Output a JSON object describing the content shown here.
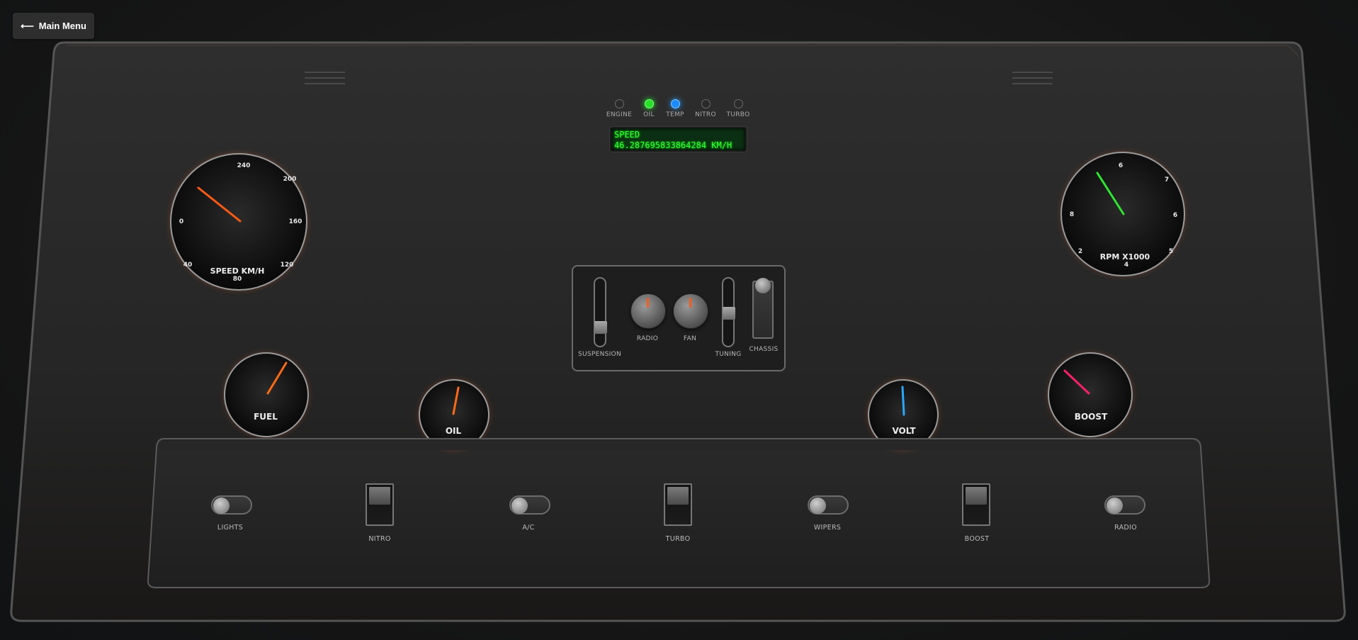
{
  "menu": {
    "arrow": "⟵",
    "label": "Main Menu",
    "icon": "arrow-left-icon"
  },
  "indicators": [
    {
      "label": "ENGINE",
      "state": "off"
    },
    {
      "label": "OIL",
      "state": "green"
    },
    {
      "label": "TEMP",
      "state": "blue"
    },
    {
      "label": "NITRO",
      "state": "off"
    },
    {
      "label": "TURBO",
      "state": "off"
    }
  ],
  "lcd": {
    "line1": "SPEED",
    "line2": "46.287695833864284 KM/H"
  },
  "gauges": {
    "speed": {
      "label": "SPEED KM/H",
      "ticks": [
        "0",
        "40",
        "80",
        "120",
        "160",
        "200",
        "240"
      ],
      "value": 46.287695833864284,
      "min": 0,
      "max": 240,
      "needle_color": "#ff5a14"
    },
    "rpm": {
      "label": "RPM X1000",
      "ticks": [
        "2",
        "4",
        "5",
        "6",
        "7",
        "6",
        "8"
      ],
      "needle_color": "#2ee62e"
    },
    "fuel": {
      "label": "FUEL",
      "needle_color": "#ff6a14"
    },
    "oil": {
      "label": "OIL",
      "needle_color": "#ff6a14"
    },
    "volt": {
      "label": "VOLT",
      "needle_color": "#28a8ff"
    },
    "boost": {
      "label": "BOOST",
      "needle_color": "#ff1f6b"
    }
  },
  "console": {
    "suspension_label": "SUSPENSION",
    "radio_knob_label": "RADIO",
    "fan_knob_label": "FAN",
    "tuning_label": "TUNING",
    "chassis_label": "CHASSIS"
  },
  "switches": [
    {
      "label": "LIGHTS",
      "kind": "toggle",
      "on": false
    },
    {
      "label": "NITRO",
      "kind": "rocker",
      "on": false
    },
    {
      "label": "A/C",
      "kind": "toggle",
      "on": false
    },
    {
      "label": "TURBO",
      "kind": "rocker",
      "on": false
    },
    {
      "label": "WIPERS",
      "kind": "toggle",
      "on": false
    },
    {
      "label": "BOOST",
      "kind": "rocker",
      "on": false
    },
    {
      "label": "RADIO",
      "kind": "toggle",
      "on": false
    }
  ]
}
